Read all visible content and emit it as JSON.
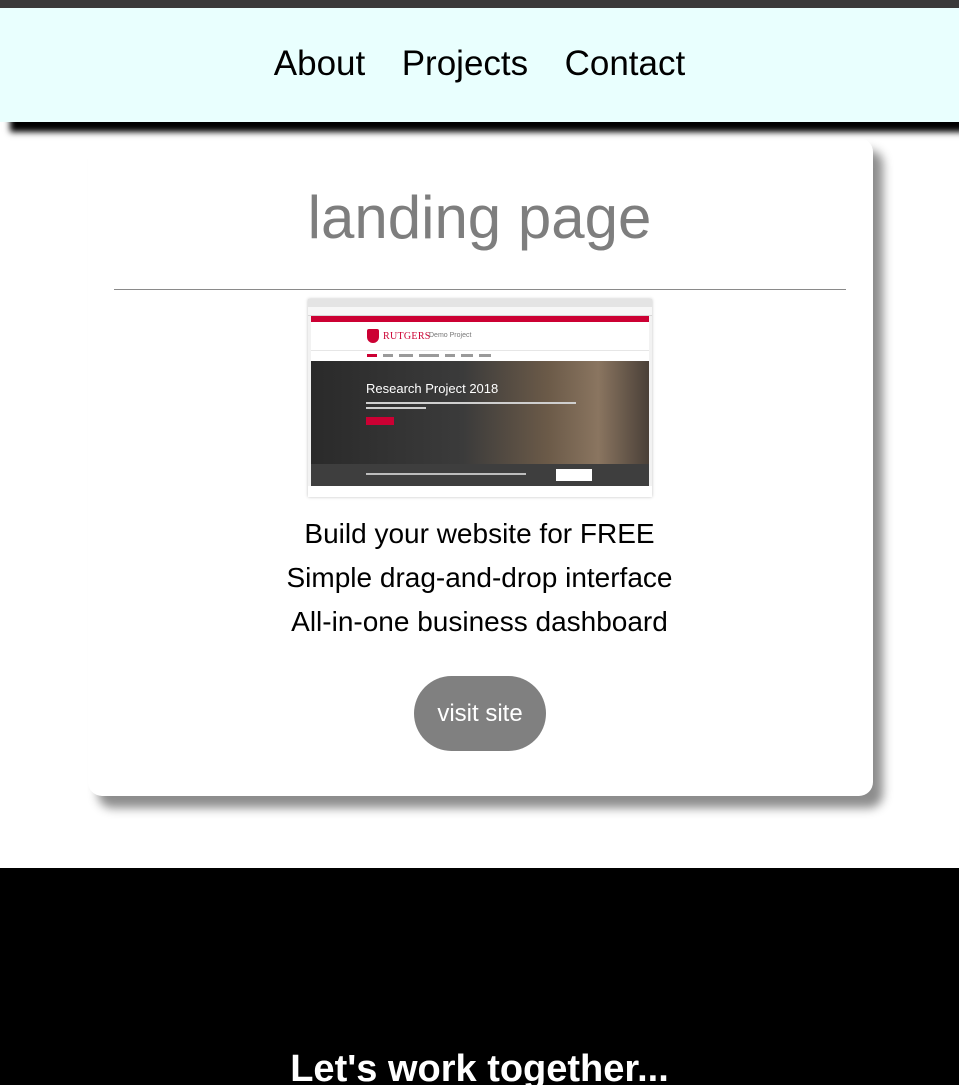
{
  "nav": {
    "links": [
      "About",
      "Projects",
      "Contact"
    ]
  },
  "project": {
    "title": "landing page",
    "screenshot": {
      "brand": "RUTGERS",
      "brand_sub": "Demo Project",
      "hero_title": "Research Project 2018"
    },
    "features": [
      "Build your website for FREE",
      "Simple drag-and-drop interface",
      "All-in-one business dashboard"
    ],
    "button_label": "visit site"
  },
  "footer": {
    "heading": "Let's work together..."
  },
  "colors": {
    "nav_bg": "#e9fffe",
    "title_gray": "#7e7e7e",
    "button_gray": "#808080",
    "footer_bg": "#000000",
    "brand_red": "#cc0033"
  }
}
